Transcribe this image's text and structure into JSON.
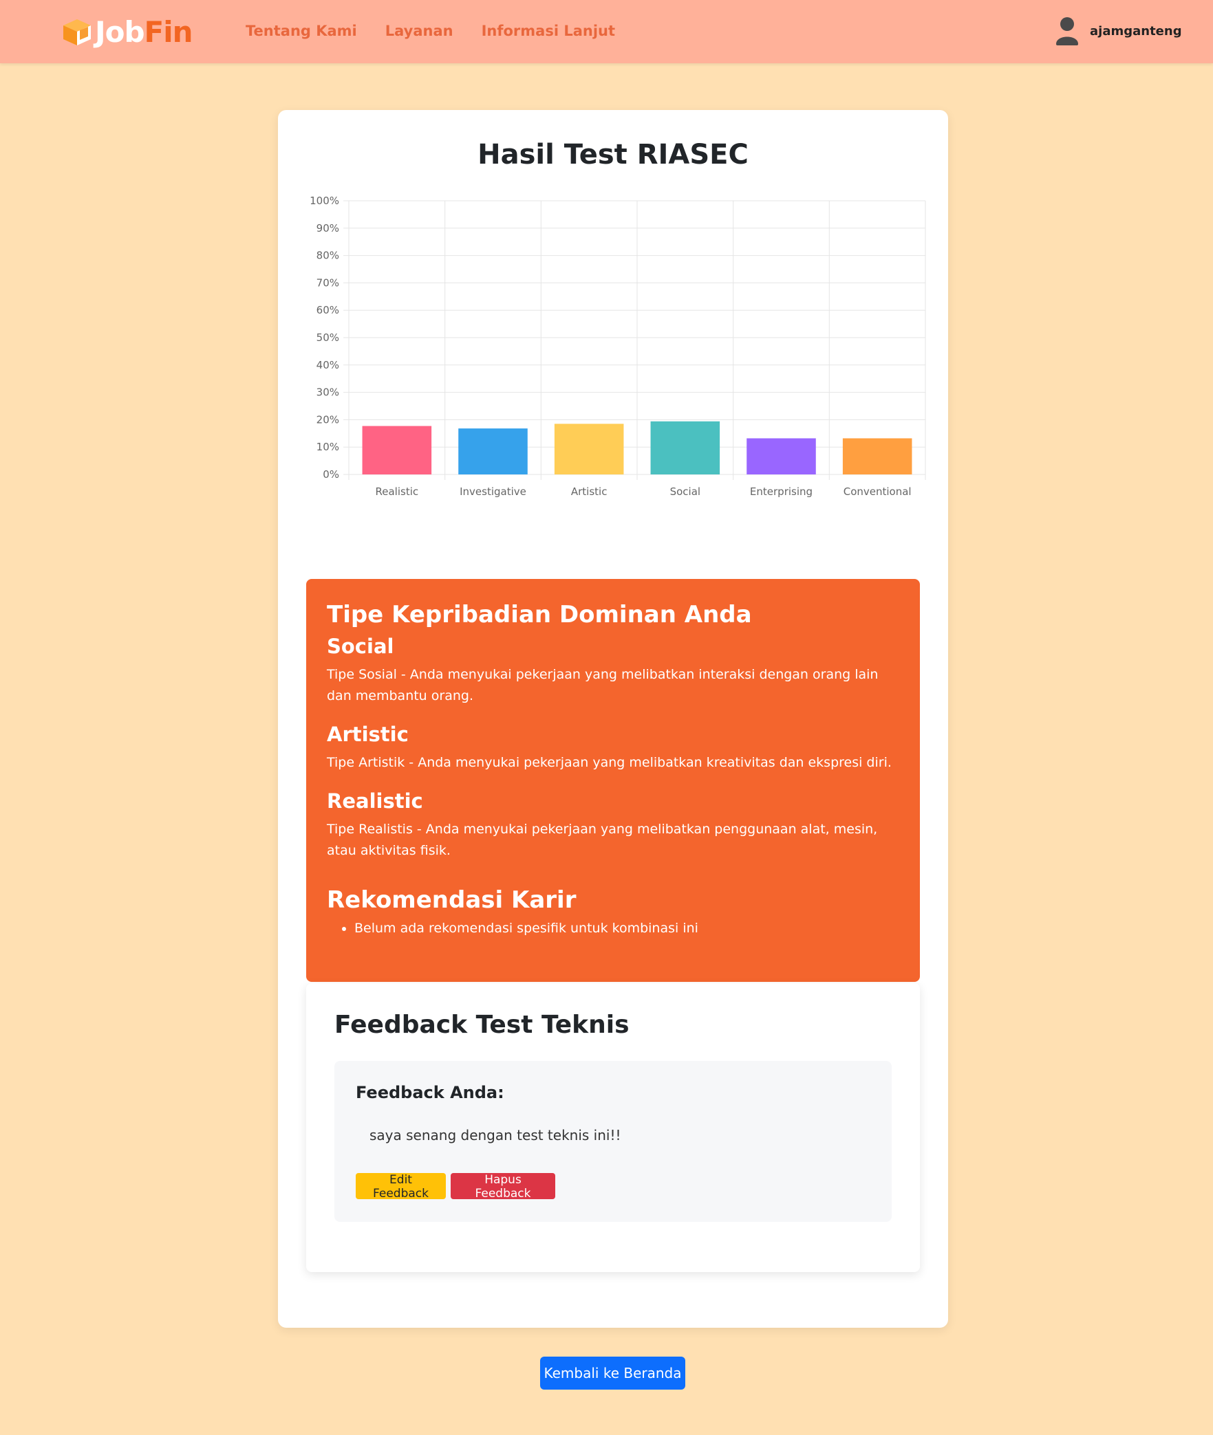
{
  "header": {
    "logo": {
      "part1": "Job",
      "part2": "Fin",
      "icon": "cube-icon"
    },
    "nav": [
      "Tentang Kami",
      "Layanan",
      "Informasi Lanjut"
    ],
    "user": {
      "name": "ajamganteng",
      "icon": "user-icon"
    }
  },
  "page": {
    "title": "Hasil Test RIASEC"
  },
  "chart_data": {
    "type": "bar",
    "categories": [
      "Realistic",
      "Investigative",
      "Artistic",
      "Social",
      "Enterprising",
      "Conventional"
    ],
    "values": [
      17.7,
      16.8,
      18.5,
      19.4,
      13.2,
      13.2
    ],
    "colors": [
      "#ff6384",
      "#36a2eb",
      "#ffcd56",
      "#4bc0c0",
      "#9966ff",
      "#ff9f40"
    ],
    "ylim": [
      0,
      100
    ],
    "yticks": [
      "0%",
      "10%",
      "20%",
      "30%",
      "40%",
      "50%",
      "60%",
      "70%",
      "80%",
      "90%",
      "100%"
    ],
    "grid": true,
    "legend": "none",
    "title": "",
    "xlabel": "",
    "ylabel": ""
  },
  "personality": {
    "heading": "Tipe Kepribadian Dominan Anda",
    "types": [
      {
        "name": "Social",
        "desc": "Tipe Sosial - Anda menyukai pekerjaan yang melibatkan interaksi dengan orang lain dan membantu orang."
      },
      {
        "name": "Artistic",
        "desc": "Tipe Artistik - Anda menyukai pekerjaan yang melibatkan kreativitas dan ekspresi diri."
      },
      {
        "name": "Realistic",
        "desc": "Tipe Realistis - Anda menyukai pekerjaan yang melibatkan penggunaan alat, mesin, atau aktivitas fisik."
      }
    ],
    "reko_heading": "Rekomendasi Karir",
    "reko_items": [
      "Belum ada rekomendasi spesifik untuk kombinasi ini"
    ]
  },
  "feedback": {
    "title": "Feedback Test Teknis",
    "label": "Feedback Anda:",
    "text": "saya senang dengan test teknis ini!!",
    "edit_label": "Edit Feedback",
    "delete_label": "Hapus Feedback"
  },
  "home_button": "Kembali ke Beranda"
}
